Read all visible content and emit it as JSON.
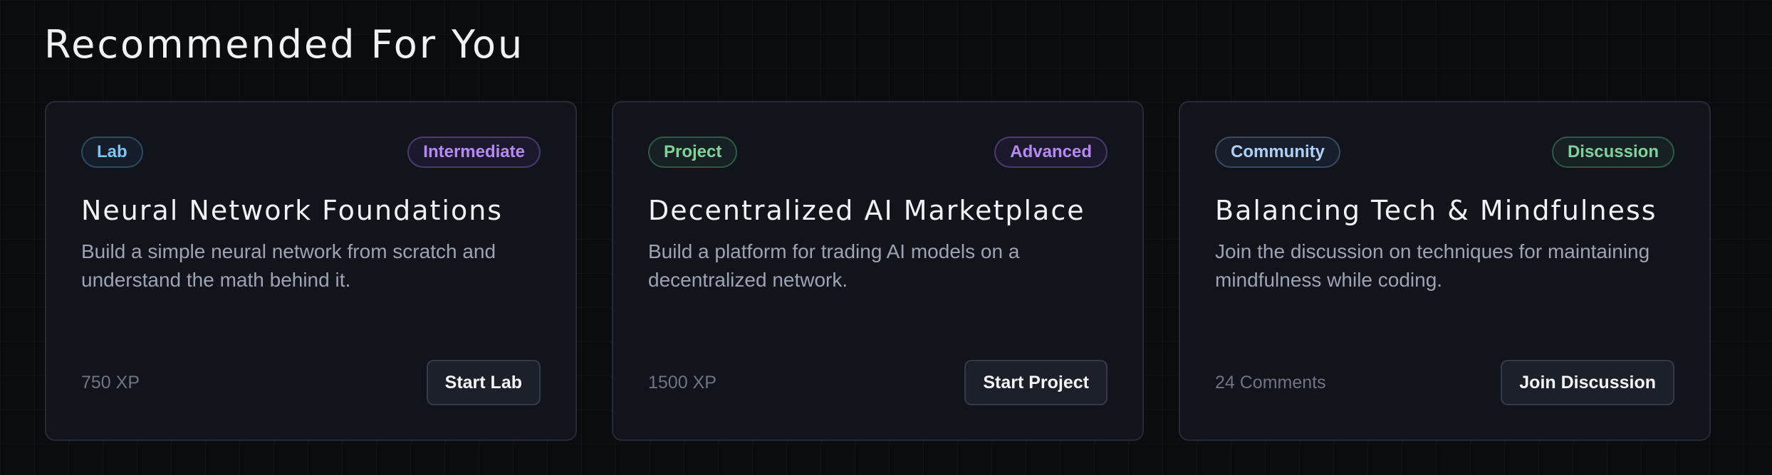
{
  "section": {
    "title": "Recommended For You"
  },
  "cards": [
    {
      "type_tag": "Lab",
      "level_tag": "Intermediate",
      "title": "Neural Network Foundations",
      "description": "Build a simple neural network from scratch and understand the math behind it.",
      "meta": "750 XP",
      "action_label": "Start Lab"
    },
    {
      "type_tag": "Project",
      "level_tag": "Advanced",
      "title": "Decentralized AI Marketplace",
      "description": "Build a platform for trading AI models on a decentralized network.",
      "meta": "1500 XP",
      "action_label": "Start Project"
    },
    {
      "type_tag": "Community",
      "level_tag": "Discussion",
      "title": "Balancing Tech & Mindfulness",
      "description": "Join the discussion on techniques for maintaining mindfulness while coding.",
      "meta": "24 Comments",
      "action_label": "Join Discussion"
    }
  ],
  "colors": {
    "background": "#0b0c10",
    "card": "#12141c",
    "tag_blue": "#7fc5f2",
    "tag_purple": "#b68af3",
    "tag_green": "#7fd39a",
    "tag_lightblue": "#aed2f7"
  }
}
